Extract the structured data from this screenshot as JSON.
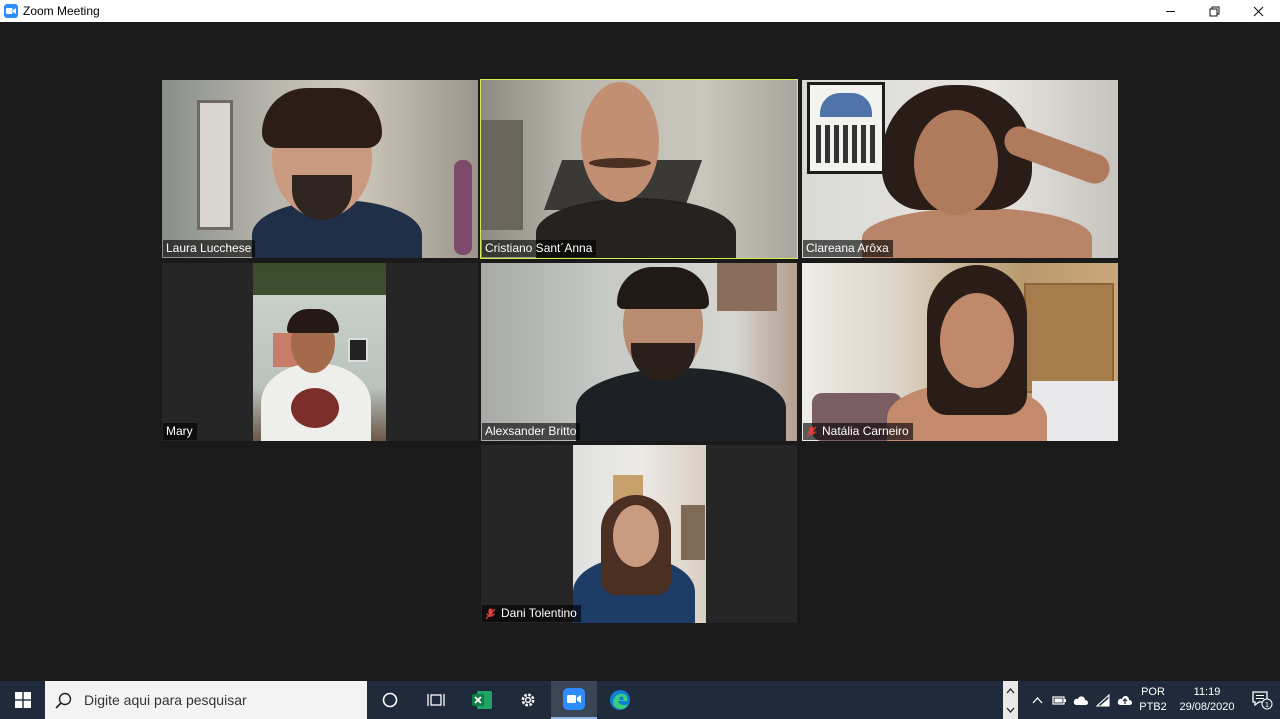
{
  "window": {
    "title": "Zoom Meeting",
    "icon": "zoom-camera-icon",
    "controls": [
      "minimize-icon",
      "restore-icon",
      "close-icon"
    ]
  },
  "participants": [
    {
      "name": "Laura Lucchese",
      "muted": false,
      "active_speaker": false
    },
    {
      "name": "Cristiano Sant´Anna",
      "muted": false,
      "active_speaker": true
    },
    {
      "name": "Clareana Arôxa",
      "muted": false,
      "active_speaker": false
    },
    {
      "name": "Mary",
      "muted": false,
      "active_speaker": false
    },
    {
      "name": "Alexsander Britto",
      "muted": false,
      "active_speaker": false
    },
    {
      "name": "Natália Carneiro",
      "muted": true,
      "active_speaker": false
    },
    {
      "name": "Dani Tolentino",
      "muted": true,
      "active_speaker": false
    }
  ],
  "colors": {
    "active_border": "#d4ec4e",
    "muted_mic": "#e0413c",
    "taskbar": "#1f2a3a",
    "zoom_blue": "#2d8cff"
  },
  "taskbar": {
    "search_placeholder": "Digite aqui para pesquisar",
    "apps": [
      "cortana-circle-icon",
      "task-view-icon",
      "excel-icon",
      "settings-gear-icon",
      "zoom-app-icon",
      "edge-browser-icon"
    ],
    "active_app": "zoom-app-icon",
    "language": "POR",
    "keyboard": "PTB2",
    "time": "11:19",
    "date": "29/08/2020",
    "notification_count": "1"
  }
}
